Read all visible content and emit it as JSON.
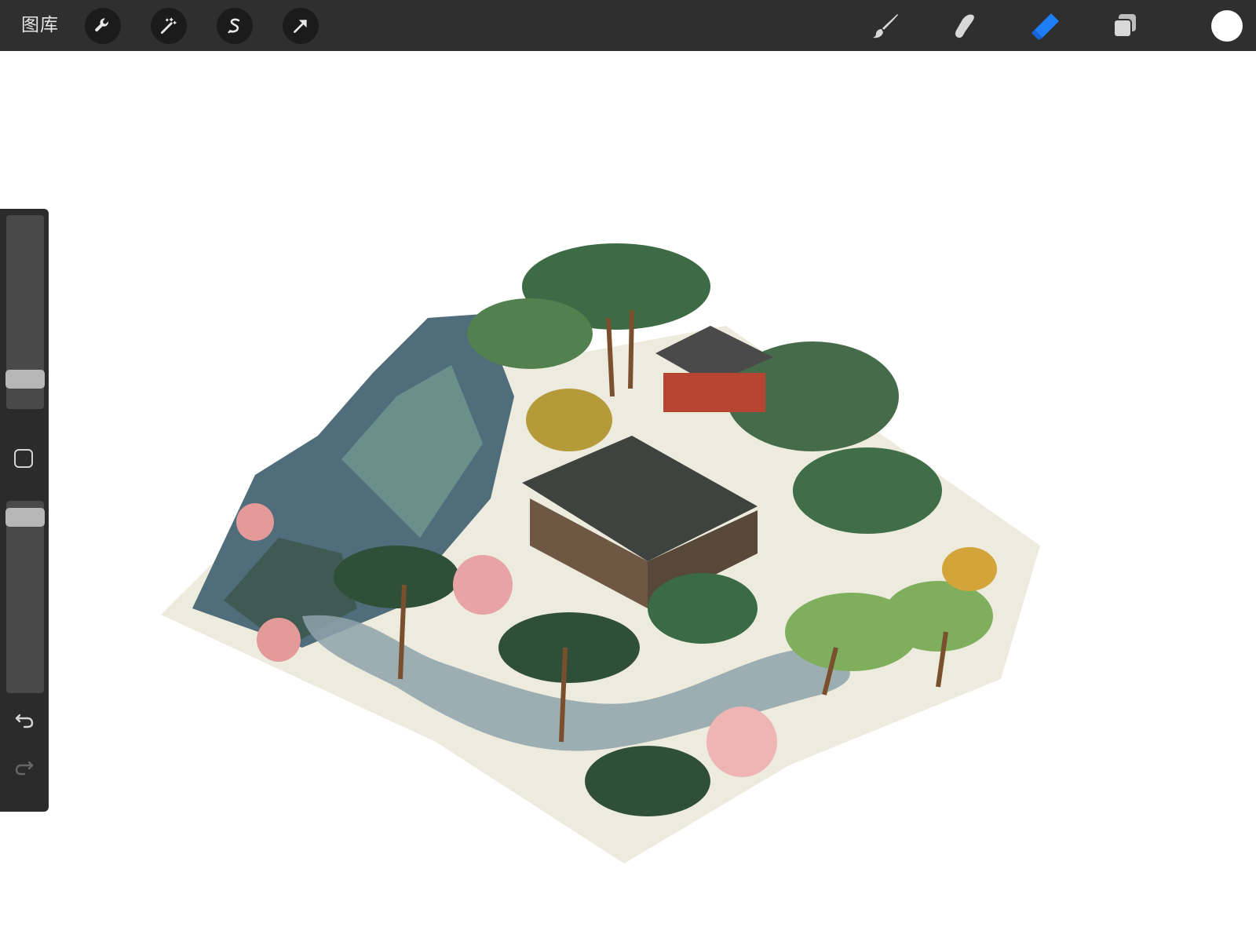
{
  "toolbar": {
    "gallery_label": "图库",
    "left_tools": [
      {
        "name": "actions",
        "icon": "wrench-icon"
      },
      {
        "name": "adjustments",
        "icon": "magic-wand-icon"
      },
      {
        "name": "selection",
        "icon": "selection-s-icon"
      },
      {
        "name": "transform",
        "icon": "arrow-cursor-icon"
      }
    ],
    "right_tools": [
      {
        "name": "brush",
        "icon": "brush-icon",
        "active": false
      },
      {
        "name": "smudge",
        "icon": "smudge-finger-icon",
        "active": false
      },
      {
        "name": "eraser",
        "icon": "eraser-icon",
        "active": true
      },
      {
        "name": "layers",
        "icon": "layers-icon",
        "active": false
      }
    ],
    "current_color": "#ffffff",
    "active_color": "#1e7ef7"
  },
  "sidebar": {
    "brush_size_level": 0.15,
    "opacity_level": 0.96,
    "modifier_icon": "square-modifier-icon",
    "undo_icon": "undo-arrow-icon",
    "redo_icon": "redo-arrow-icon"
  },
  "canvas": {
    "background": "#ffffff",
    "artwork_subject": "isometric-chinese-garden-illustration"
  }
}
